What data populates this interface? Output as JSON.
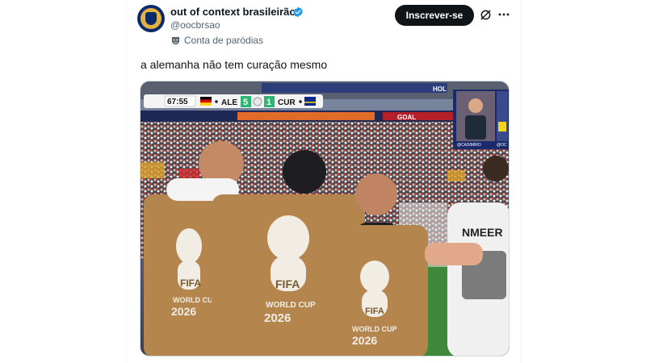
{
  "tweet": {
    "display_name": "out of context brasileirão",
    "handle": "@oocbrsao",
    "parody_label": "Conta de paródias",
    "subscribe_label": "Inscrever-se",
    "text": "a alemanha não tem curação mesmo"
  },
  "media": {
    "scoreboard": {
      "time": "67:55",
      "home_team": "ALE",
      "home_score": "5",
      "away_score": "1",
      "away_team": "CUR"
    },
    "banner_text": "GOAL",
    "stadium_sign": "HOL",
    "streamer_tag_left": "@CASIMIRO",
    "streamer_tag_right": "@OC",
    "player_name": "NMEER",
    "vest_brand": "FIFA",
    "vest_event": "WORLD CUP",
    "vest_year": "2026",
    "colors": {
      "vest": "#b5854e",
      "pitch": "#3f8a3a",
      "crowd": "#3a3a44",
      "score_green": "#2bb673"
    }
  },
  "colors": {
    "text_primary": "#0f1419",
    "text_secondary": "#536471",
    "verified_blue": "#1d9bf0",
    "button_bg": "#0f1419"
  }
}
